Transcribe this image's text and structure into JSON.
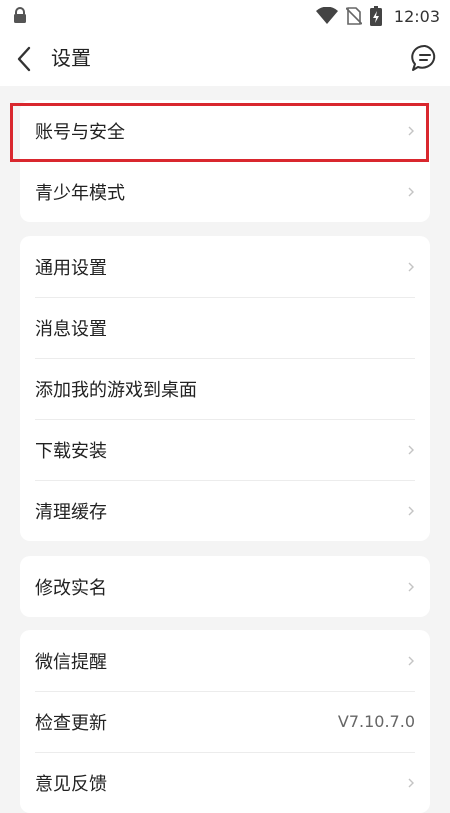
{
  "status_bar": {
    "time": "12:03",
    "icons": [
      "lock-icon",
      "wifi-icon",
      "no-sim-icon",
      "battery-charging-icon"
    ]
  },
  "header": {
    "title": "设置",
    "back_icon": "back-icon",
    "message_icon": "chat-bubble-icon"
  },
  "groups": [
    {
      "items": [
        {
          "label": "账号与安全",
          "chevron": true
        },
        {
          "label": "青少年模式",
          "chevron": true
        }
      ]
    },
    {
      "items": [
        {
          "label": "通用设置",
          "chevron": true
        },
        {
          "label": "消息设置",
          "chevron": false
        },
        {
          "label": "添加我的游戏到桌面",
          "chevron": false
        },
        {
          "label": "下载安装",
          "chevron": true
        },
        {
          "label": "清理缓存",
          "chevron": true
        }
      ]
    },
    {
      "items": [
        {
          "label": "修改实名",
          "chevron": true
        }
      ]
    },
    {
      "items": [
        {
          "label": "微信提醒",
          "chevron": true
        },
        {
          "label": "检查更新",
          "value": "V7.10.7.0"
        },
        {
          "label": "意见反馈",
          "chevron": true
        }
      ]
    }
  ],
  "highlight": {
    "target": "账号与安全",
    "color": "#d9272e"
  },
  "colors": {
    "background": "#f4f4f4",
    "card": "#ffffff",
    "divider": "#ececec"
  }
}
